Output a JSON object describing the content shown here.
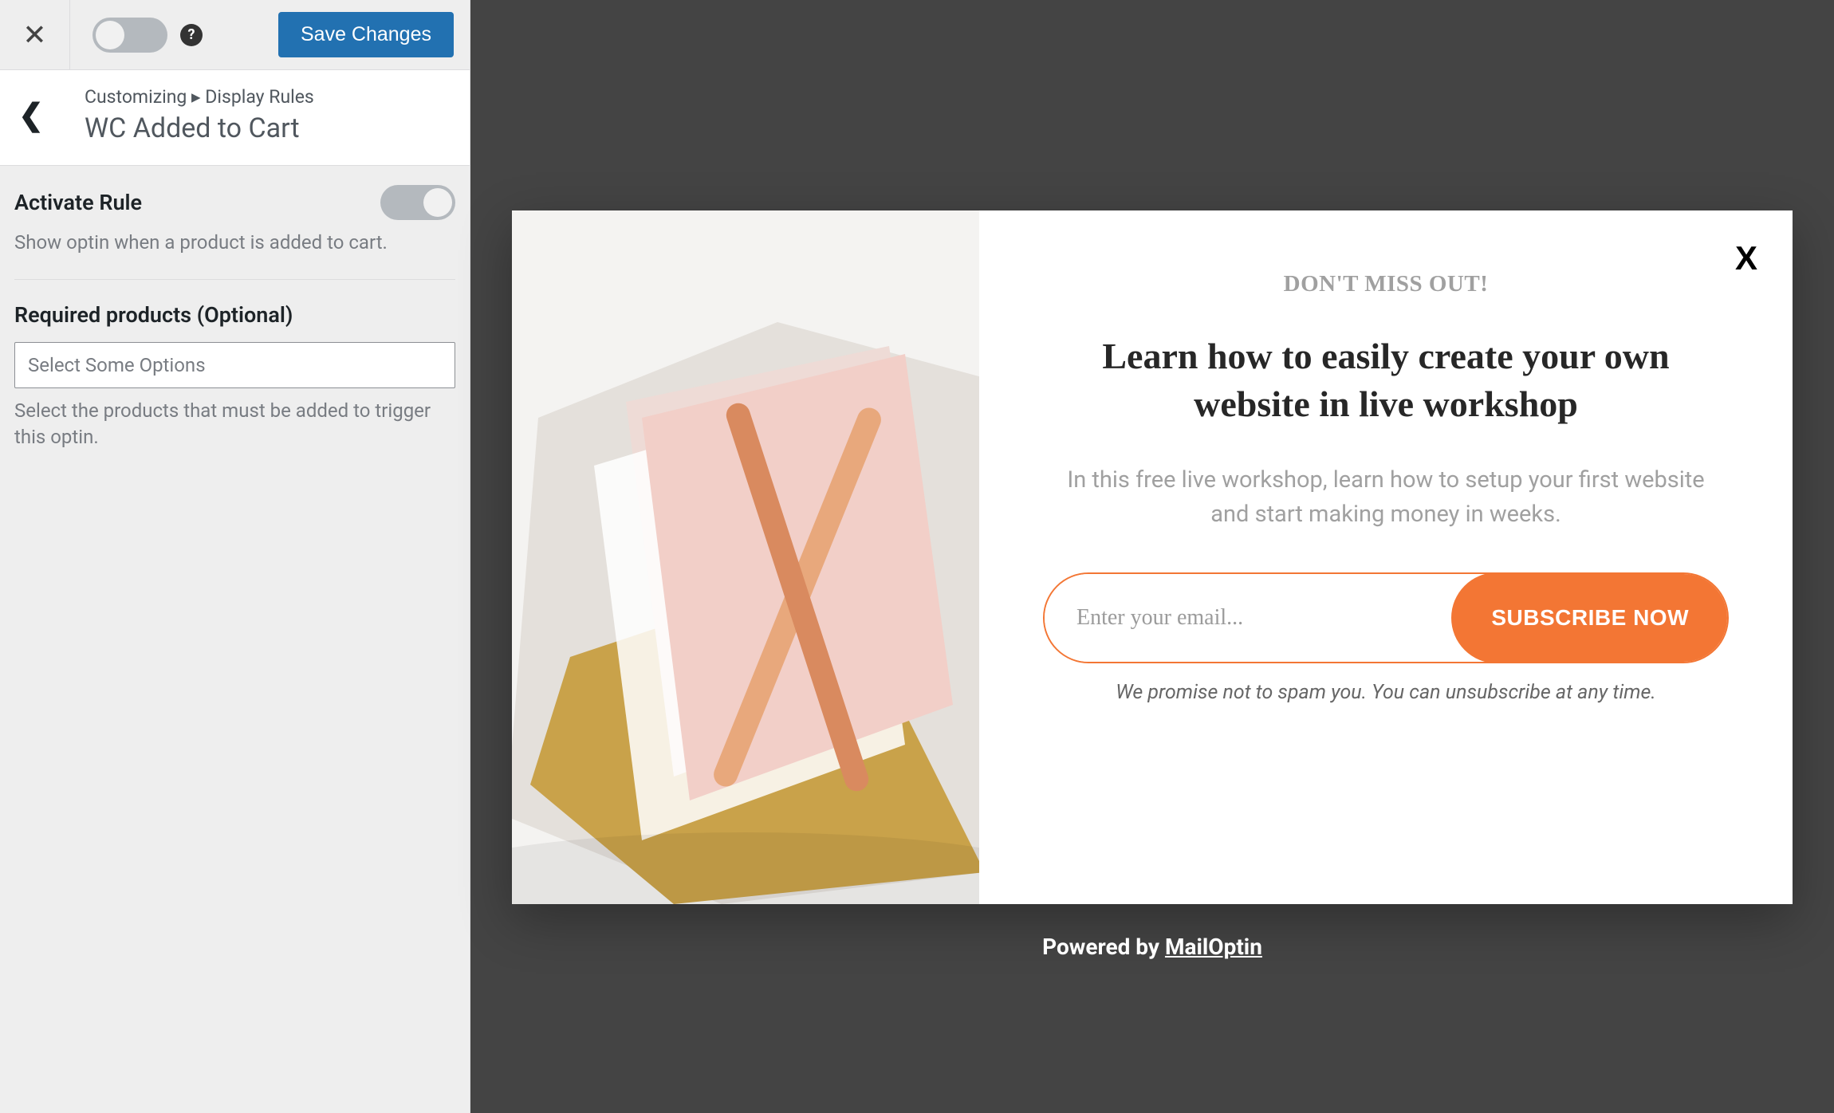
{
  "header": {
    "save_label": "Save Changes"
  },
  "breadcrumb": {
    "path": "Customizing ▸ Display Rules",
    "title": "WC Added to Cart"
  },
  "settings": {
    "activate": {
      "title": "Activate Rule",
      "desc": "Show optin when a product is added to cart."
    },
    "products": {
      "title": "Required products (Optional)",
      "placeholder": "Select Some Options",
      "desc": "Select the products that must be added to trigger this optin."
    }
  },
  "optin": {
    "eyebrow": "DON'T MISS OUT!",
    "headline": "Learn how to easily create your own website in live workshop",
    "sub": "In this free live workshop, learn how to setup your first website and start making money in weeks.",
    "email_placeholder": "Enter your email...",
    "submit_label": "SUBSCRIBE NOW",
    "disclaimer": "We promise not to spam you. You can unsubscribe at any time.",
    "close_label": "X"
  },
  "powered": {
    "prefix": "Powered by ",
    "brand": "MailOptin"
  }
}
